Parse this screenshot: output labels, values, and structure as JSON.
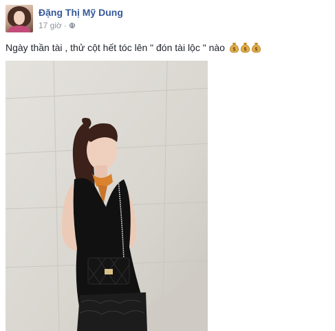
{
  "post": {
    "author_name": "Đặng Thị Mỹ Dung",
    "timestamp": "17 giờ",
    "separator": "·",
    "privacy_icon": "globe-icon",
    "caption": "Ngày thần tài , thử cột hết tóc lên \" đón tài lộc \" nào",
    "caption_emojis": [
      "money-bag-icon",
      "money-bag-icon",
      "money-bag-icon"
    ],
    "colors": {
      "link": "#365899",
      "text": "#1d2129",
      "meta": "#90949c"
    }
  }
}
